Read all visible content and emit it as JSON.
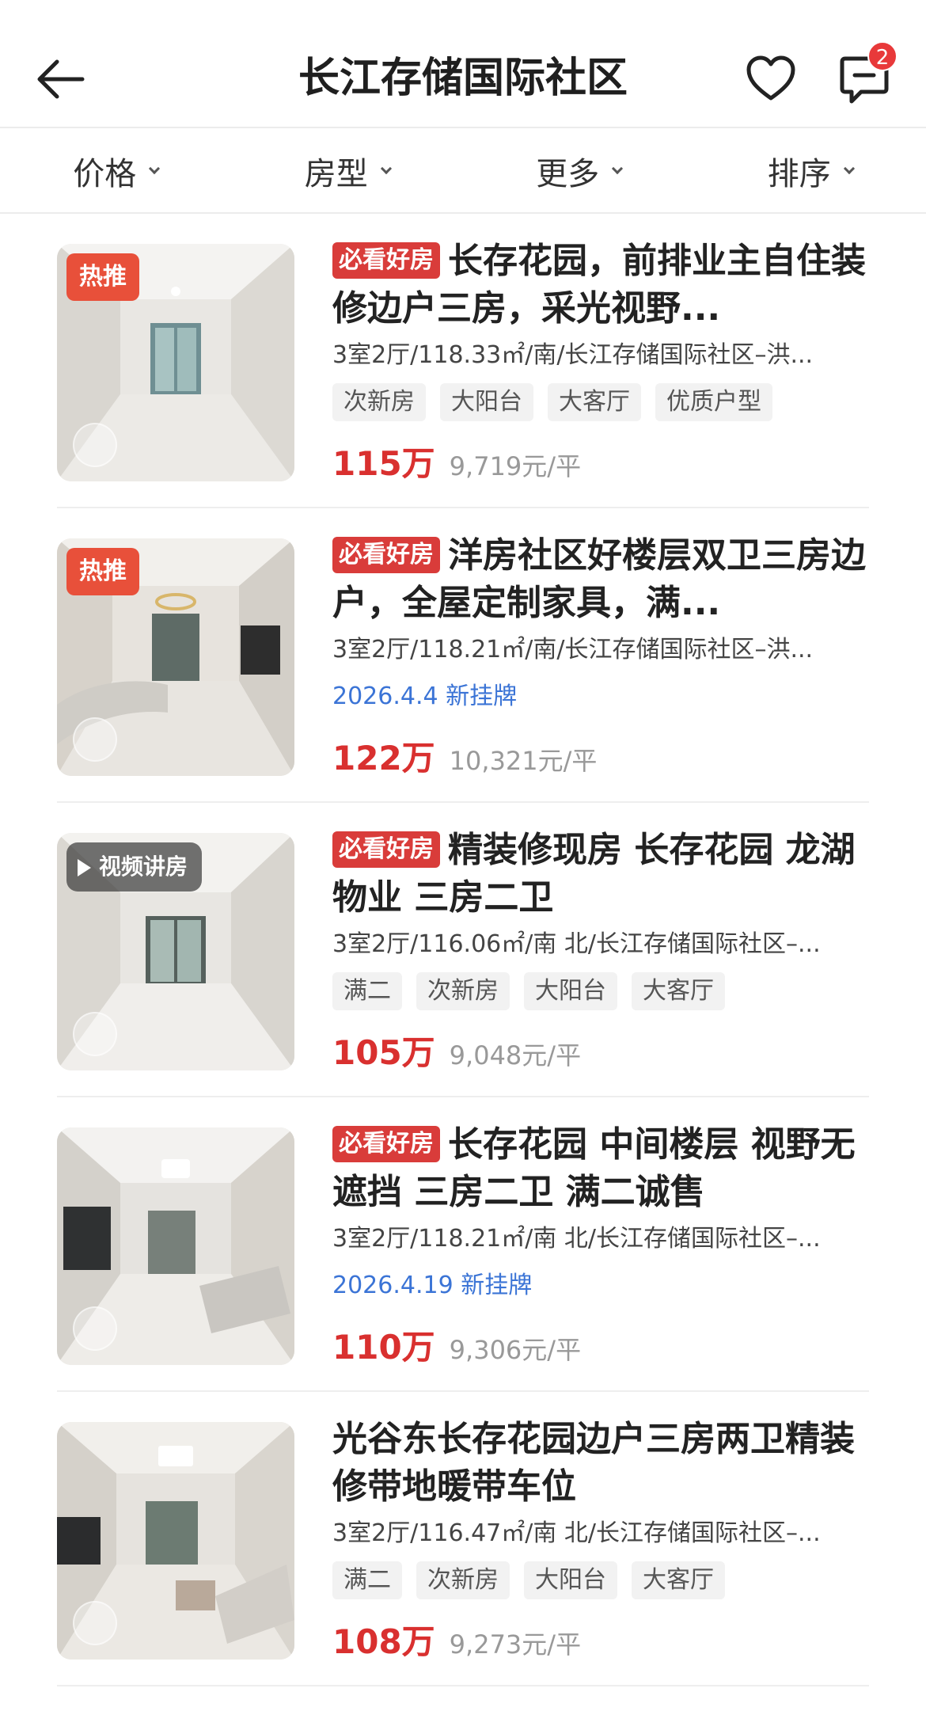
{
  "header": {
    "title": "长江存储国际社区",
    "message_badge": "2"
  },
  "filters": [
    {
      "label": "价格"
    },
    {
      "label": "房型"
    },
    {
      "label": "更多"
    },
    {
      "label": "排序"
    }
  ],
  "listings": [
    {
      "thumb_tag": "热推",
      "must_see": "必看好房",
      "title": "长存花园，前排业主自住装修边户三房，采光视野...",
      "meta": "3室2厅/118.33㎡/南/长江存储国际社区–洪...",
      "tags": [
        "次新房",
        "大阳台",
        "大客厅",
        "优质户型"
      ],
      "new_listing": "",
      "price": "115万",
      "unit_price": "9,719元/平"
    },
    {
      "thumb_tag": "热推",
      "must_see": "必看好房",
      "title": "洋房社区好楼层双卫三房边户，全屋定制家具，满...",
      "meta": "3室2厅/118.21㎡/南/长江存储国际社区–洪...",
      "tags": [],
      "new_listing": "2026.4.4 新挂牌",
      "price": "122万",
      "unit_price": "10,321元/平"
    },
    {
      "video_tag": "视频讲房",
      "must_see": "必看好房",
      "title": "精装修现房 长存花园 龙湖物业 三房二卫",
      "meta": "3室2厅/116.06㎡/南 北/长江存储国际社区–...",
      "tags": [
        "满二",
        "次新房",
        "大阳台",
        "大客厅"
      ],
      "new_listing": "",
      "price": "105万",
      "unit_price": "9,048元/平"
    },
    {
      "must_see": "必看好房",
      "title": "长存花园 中间楼层 视野无遮挡 三房二卫 满二诚售",
      "meta": "3室2厅/118.21㎡/南 北/长江存储国际社区–...",
      "tags": [],
      "new_listing": "2026.4.19 新挂牌",
      "price": "110万",
      "unit_price": "9,306元/平"
    },
    {
      "must_see": "",
      "title": "光谷东长存花园边户三房两卫精装修带地暖带车位",
      "meta": "3室2厅/116.47㎡/南 北/长江存储国际社区–...",
      "tags": [
        "满二",
        "次新房",
        "大阳台",
        "大客厅"
      ],
      "new_listing": "",
      "price": "108万",
      "unit_price": "9,273元/平"
    }
  ]
}
